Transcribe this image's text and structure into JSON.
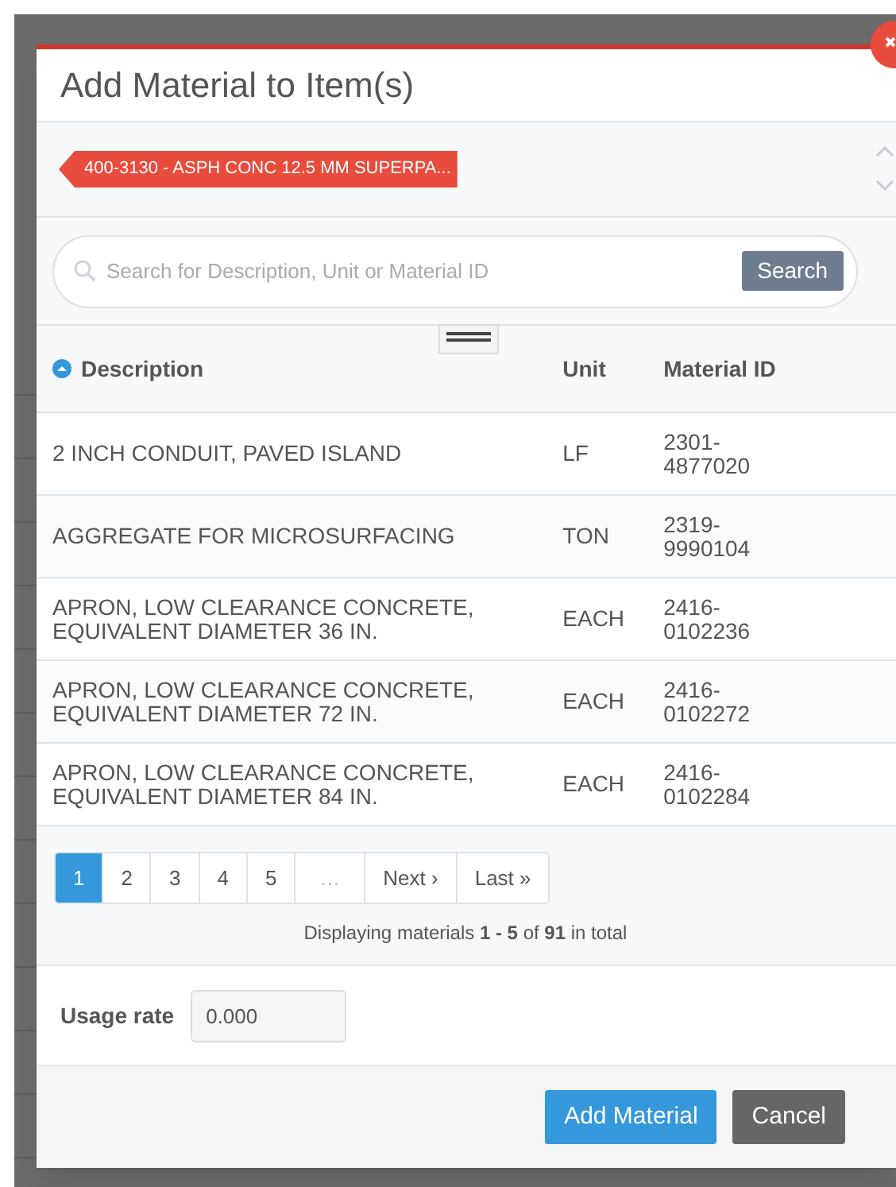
{
  "dialog": {
    "title": "Add Material to Item(s)",
    "item_tag": "400-3130 - ASPH CONC 12.5 MM SUPERPA...",
    "search": {
      "placeholder": "Search for Description, Unit or Material ID",
      "button": "Search"
    },
    "table": {
      "columns": [
        {
          "label": "Description",
          "sorted": true
        },
        {
          "label": "Unit",
          "sorted": false
        },
        {
          "label": "Material ID",
          "sorted": false
        }
      ],
      "rows": [
        {
          "description": "2 INCH CONDUIT, PAVED ISLAND",
          "unit": "LF",
          "material_id": "2301-\n4877020"
        },
        {
          "description": "AGGREGATE FOR MICROSURFACING",
          "unit": "TON",
          "material_id": "2319-\n9990104"
        },
        {
          "description": "APRON, LOW CLEARANCE CONCRETE,\nEQUIVALENT DIAMETER 36 IN.",
          "unit": "EACH",
          "material_id": "2416-\n0102236"
        },
        {
          "description": "APRON, LOW CLEARANCE CONCRETE,\nEQUIVALENT DIAMETER 72 IN.",
          "unit": "EACH",
          "material_id": "2416-\n0102272"
        },
        {
          "description": "APRON, LOW CLEARANCE CONCRETE,\nEQUIVALENT DIAMETER 84 IN.",
          "unit": "EACH",
          "material_id": "2416-\n0102284"
        }
      ]
    },
    "pagination": [
      {
        "label": "1",
        "selected": true,
        "disabled": false
      },
      {
        "label": "2",
        "selected": false,
        "disabled": false
      },
      {
        "label": "3",
        "selected": false,
        "disabled": false
      },
      {
        "label": "4",
        "selected": false,
        "disabled": false
      },
      {
        "label": "5",
        "selected": false,
        "disabled": false
      },
      {
        "label": "…",
        "selected": false,
        "disabled": true
      },
      {
        "label": "Next ›",
        "selected": false,
        "disabled": false
      },
      {
        "label": "Last »",
        "selected": false,
        "disabled": false
      }
    ],
    "summary": "Displaying materials **1 - 5** of **91** in total",
    "usage_rate": {
      "label": "Usage rate",
      "value": "0.000"
    },
    "buttons": [
      {
        "label": "Add Material",
        "kind": "primary"
      },
      {
        "label": "Cancel",
        "kind": "secondary"
      }
    ]
  }
}
